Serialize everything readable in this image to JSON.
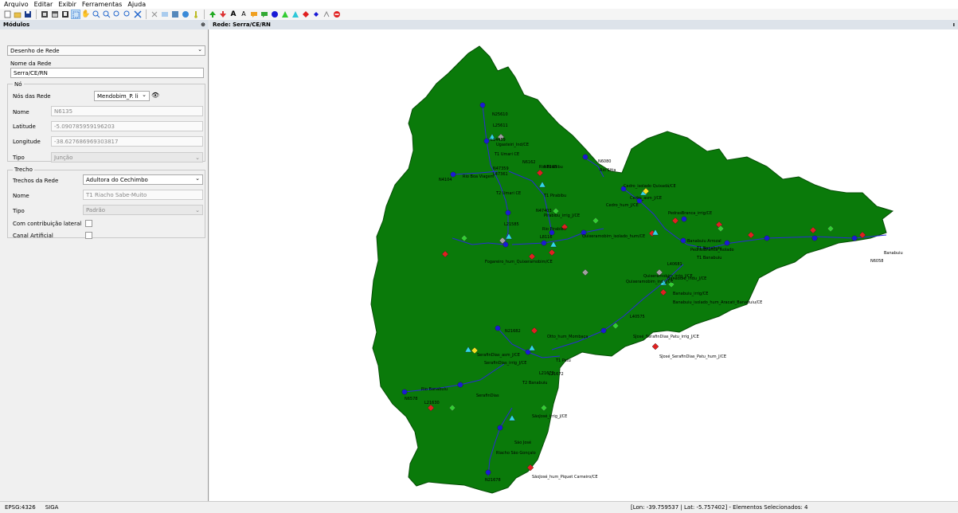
{
  "menu": [
    "Arquivo",
    "Editar",
    "Exibir",
    "Ferramentas",
    "Ajuda"
  ],
  "panel": {
    "title": "Módulos",
    "pin": "⊕",
    "module_select": "Desenho de Rede",
    "nome_da_rede_label": "Nome da Rede",
    "nome_da_rede_value": "Serra/CE/RN",
    "no_group": "Nó",
    "nos_da_rede_label": "Nós das Rede",
    "nos_da_rede_value": "Mendobim_P. li",
    "nome_label": "Nome",
    "nome_value": "N6135",
    "latitude_label": "Latitude",
    "latitude_value": "-5.090785959196203",
    "longitude_label": "Longitude",
    "longitude_value": "-38.627686969303817",
    "tipo_label": "Tipo",
    "tipo_value": "Junção",
    "trecho_group": "Trecho",
    "trechos_label": "Trechos da Rede",
    "trechos_value": "Adultora do Cechimbo",
    "trecho_nome_label": "Nome",
    "trecho_nome_value": "T1 Riacho Sabe-Muito",
    "trecho_tipo_label": "Tipo",
    "trecho_tipo_value": "Padrão",
    "contribuicao_label": "Com contribuição lateral",
    "canal_label": "Canal Artificial"
  },
  "map_title": "Rede: Serra/CE/RN",
  "status": {
    "epsg": "EPSG:4326",
    "app": "SIGA",
    "coords": "[Lon: -39.759537 | Lat: -5.757402] - Elementos Selecionados: 4"
  },
  "colors": {
    "basin": "#0a7a0a",
    "node": "#1a1ad6",
    "red": "#e02020",
    "green": "#33cc33",
    "cyan": "#30d8e8",
    "gray": "#a0a0a0",
    "yellow": "#f0e020"
  },
  "map_labels": [
    "N25610",
    "L25611",
    "L14459",
    "T1 Umari CE",
    "Ugasteiri_Ind/CE",
    "N47359",
    "L47361",
    "N4104",
    "Rio Boa Viagem",
    "N6162",
    "T2 Umari CE",
    "Rio Pirabibu",
    "N6163",
    "N6080",
    "Rio Sitia",
    "Cedro_isolado Quixadá/CE",
    "Cedro_asm_J/CE",
    "Cedro_hum_J/CE",
    "N47403",
    "T1 Pirabibu",
    "Pirabibu_irrig_J/CE",
    "L21585",
    "Rio Pirabibu",
    "L8116",
    "Quixeramobim_isolado_hum/CE",
    "PedrasBranca_irrig/CE",
    "Fogareiro_hum_Quixeramobim/CE",
    "Quixeramobim_irrig_J/CE",
    "Quixeramobim_ind_J/CE",
    "L40681",
    "Banabuiu_indu_J/CE",
    "Banabuiu_irrig/CE",
    "Banabuiu_isolado_hum_Aracati_Banabuiu/CE",
    "PedrasBranca_isolado",
    "T1 Banabuiu",
    "N6058",
    "Banabuiu",
    "L40575",
    "N21682",
    "Otto_hum_Mombaça",
    "SJosé_SerafinDias_Patu_irrig_J/CE",
    "SJosé_SerafinDias_Patu_hum_J/CE",
    "SerafinDias_asm_J/CE",
    "T1 Patu",
    "SerafinDias_irrig_J/CE",
    "L21673",
    "L21672",
    "T2 Banabuiu",
    "N6578",
    "Rio Banabuiu",
    "L21630",
    "SerafinDias",
    "SãoJosé_irrig_J/CE",
    "São José",
    "Riacho São Gonçalo",
    "SãoJosé_hum_Piquet Carneiro/CE",
    "N21678",
    "T1 Banabuiu",
    "Banabuiu Arrozal"
  ]
}
